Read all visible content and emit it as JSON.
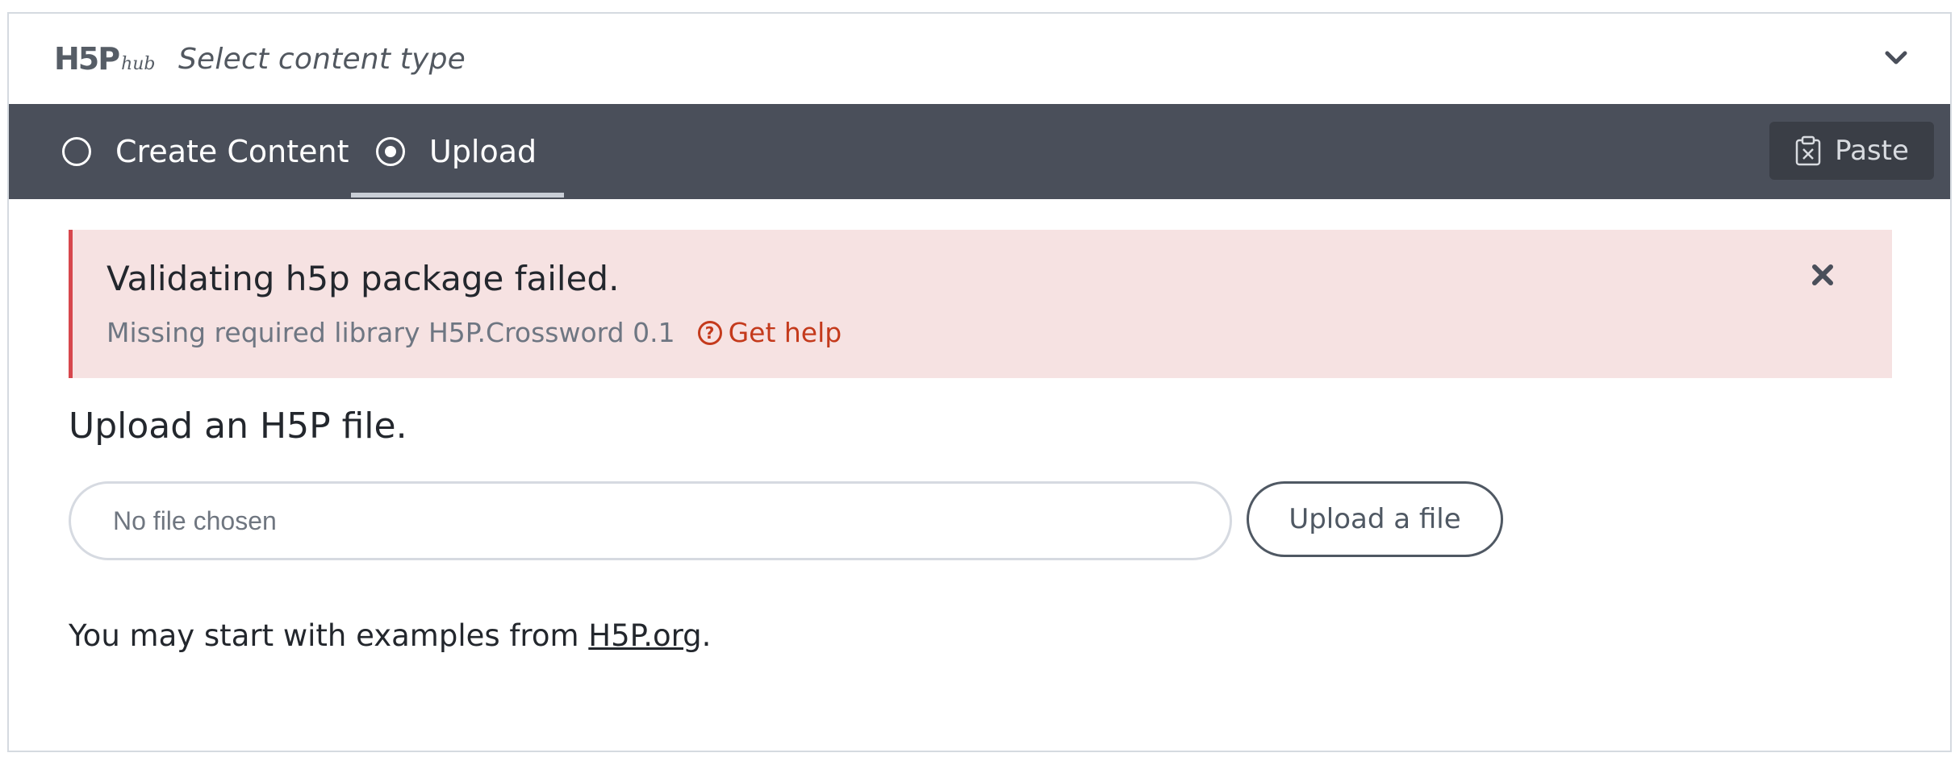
{
  "hub": {
    "logo_text": "H5P",
    "logo_sub": "hub",
    "title": "Select content type"
  },
  "tabs": {
    "create_label": "Create Content",
    "upload_label": "Upload",
    "selected": "Upload"
  },
  "toolbar": {
    "paste_label": "Paste"
  },
  "alert": {
    "title": "Validating h5p package failed.",
    "message": "Missing required library H5P.Crossword 0.1",
    "help_label": "Get help"
  },
  "upload": {
    "heading": "Upload an H5P file.",
    "file_value": "No file chosen",
    "button_label": "Upload a file"
  },
  "examples": {
    "prefix": "You may start with examples from",
    "link_label": "H5P.org",
    "suffix": "."
  },
  "colors": {
    "tabbar_bg": "#4a4f5a",
    "alert_bg": "#f6e2e2",
    "alert_border": "#d7474d",
    "help_link": "#c43a1c"
  }
}
